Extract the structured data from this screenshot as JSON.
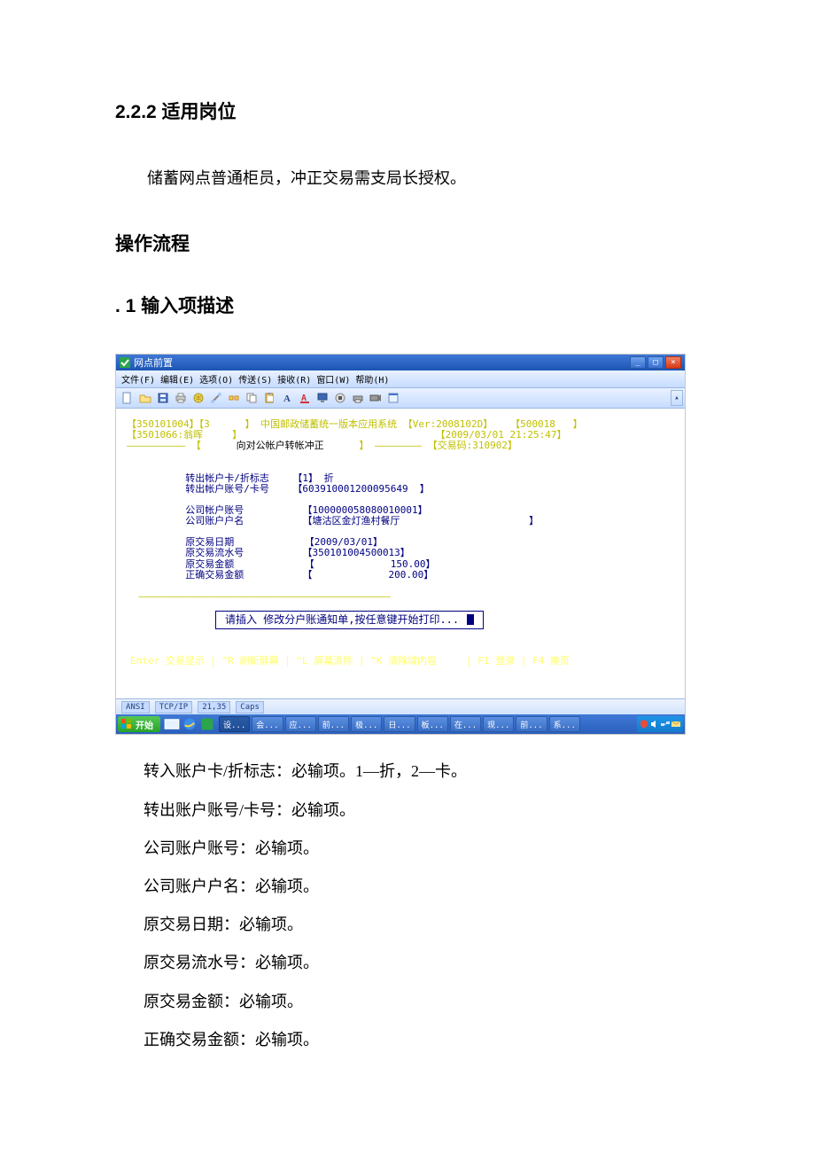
{
  "doc": {
    "h1": "2.2.2 适用岗位",
    "p1": "储蓄网点普通柜员，冲正交易需支局长授权。",
    "h2": "操作流程",
    "h3": ". 1 输入项描述",
    "m1": "转入账户卡/折标志：必输项。1—折，2—卡。",
    "m2": "转出账户账号/卡号：必输项。",
    "m3": "公司账户账号：必输项。",
    "m4": "公司账户户名：必输项。",
    "m5": "原交易日期：必输项。",
    "m6": "原交易流水号：必输项。",
    "m7": "原交易金额：必输项。",
    "m8": "正确交易金额：必输项。"
  },
  "app": {
    "window_title": "网点前置",
    "menu": {
      "file": "文件(F)",
      "edit": "编辑(E)",
      "select": "选项(O)",
      "transfer": "传送(S)",
      "receive": "接收(R)",
      "window": "窗口(W)",
      "help": "帮助(H)"
    },
    "header": {
      "left1": "【350101004】【3",
      "left2": "【3501066:翁晖",
      "sys": "】 中国邮政储蓄统一版本应用系统 【Ver:2008102D】",
      "right1a": "【500018   】",
      "right1b": "【2009/03/01 21:25:47】",
      "closeb": "】",
      "operation": "向对公帐户转帐冲正",
      "txcode": "】 ———————— 【交易码:310902】",
      "hr_left": "—————————— 【",
      "hr_mid_b": "】 ————————————————————————————————————"
    },
    "fields": {
      "f1_label": "转出帐户卡/折标志",
      "f1_value": "【1】 折",
      "f2_label": "转出帐户账号/卡号",
      "f2_value": "【603910001200095649  】",
      "f3_label": "公司帐户账号",
      "f3_value": "【100000058080010001】",
      "f4_label": "公司账户户名",
      "f4_value": "【塘沽区金灯渔村餐厅                      】",
      "f5_label": "原交易日期",
      "f5_value": "【2009/03/01】",
      "f6_label": "原交易流水号",
      "f6_value": "【350101004500013】",
      "f7_label": "原交易金额",
      "f7_value": "【             150.00】",
      "f8_label": "正确交易金额",
      "f8_value": "【             200.00】"
    },
    "hr_bottom": "———————————————————————————————————————————",
    "prompt": "请插入 修改分户账通知单,按任意键开始打印...",
    "fkeys": "Enter 交易显示 | ^R 刷新屏幕 | ^L 屏幕清除 | ^K 清除域内容     | F1 登录 | F4 换页",
    "status": {
      "a": "ANSI",
      "b": "TCP/IP",
      "c": "21,35",
      "d": "Caps"
    }
  },
  "taskbar": {
    "start": "开始",
    "items": [
      "设...",
      "会...",
      "应...",
      "前...",
      "极...",
      "日...",
      "板...",
      "在...",
      "现...",
      "前...",
      "系..."
    ]
  }
}
